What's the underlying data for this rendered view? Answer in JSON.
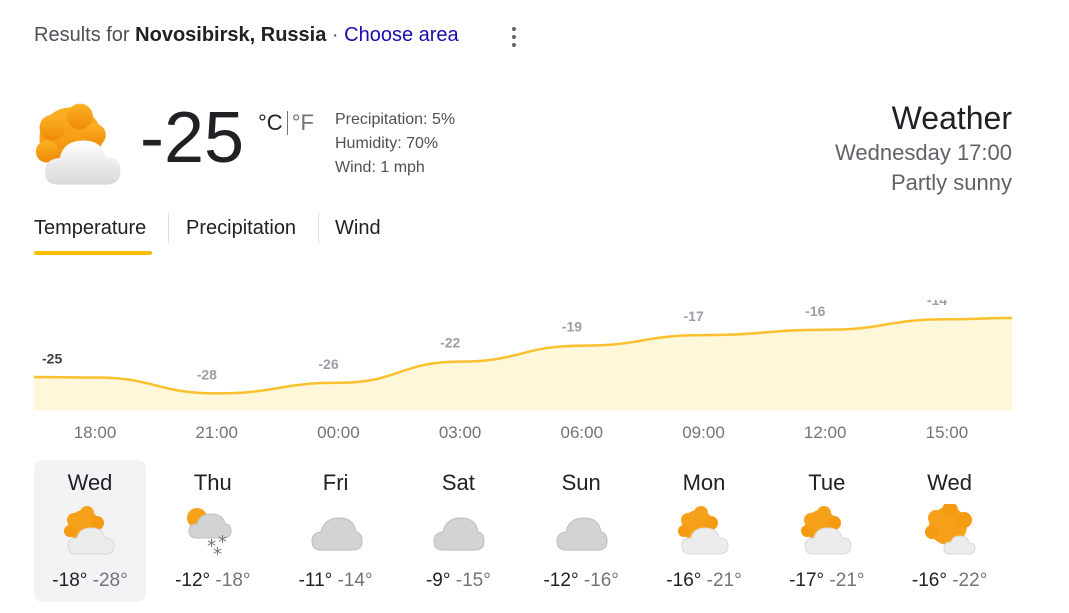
{
  "header": {
    "results_prefix": "Results for",
    "location": "Novosibirsk, Russia",
    "separator": "·",
    "choose_area": "Choose area"
  },
  "current": {
    "icon": "partly-sunny-icon",
    "temperature": "-25",
    "unit_c": "°C",
    "unit_f": "°F",
    "precipitation": "Precipitation: 5%",
    "humidity": "Humidity: 70%",
    "wind": "Wind: 1 mph"
  },
  "summary": {
    "title": "Weather",
    "datetime": "Wednesday 17:00",
    "condition": "Partly sunny"
  },
  "tabs": [
    {
      "label": "Temperature",
      "selected": true
    },
    {
      "label": "Precipitation",
      "selected": false
    },
    {
      "label": "Wind",
      "selected": false
    }
  ],
  "chart_data": {
    "type": "area",
    "values": [
      -25,
      -28,
      -26,
      -22,
      -19,
      -17,
      -16,
      -14
    ],
    "labels": [
      "-25",
      "-28",
      "-26",
      "-22",
      "-19",
      "-17",
      "-16",
      "-14"
    ],
    "times": [
      "18:00",
      "21:00",
      "00:00",
      "03:00",
      "06:00",
      "09:00",
      "12:00",
      "15:00"
    ],
    "line_color": "#fbc02d",
    "fill_color": "#fef7d9",
    "label_color_current": "#3c4043",
    "label_color_other": "#9aa0a6"
  },
  "days": [
    {
      "name": "Wed",
      "icon": "partly-sunny-icon",
      "high": "-18°",
      "low": "-28°",
      "selected": true
    },
    {
      "name": "Thu",
      "icon": "snow-partly-cloudy-icon",
      "high": "-12°",
      "low": "-18°",
      "selected": false
    },
    {
      "name": "Fri",
      "icon": "cloudy-icon",
      "high": "-11°",
      "low": "-14°",
      "selected": false
    },
    {
      "name": "Sat",
      "icon": "cloudy-icon",
      "high": "-9°",
      "low": "-15°",
      "selected": false
    },
    {
      "name": "Sun",
      "icon": "cloudy-icon",
      "high": "-12°",
      "low": "-16°",
      "selected": false
    },
    {
      "name": "Mon",
      "icon": "partly-sunny-icon",
      "high": "-16°",
      "low": "-21°",
      "selected": false
    },
    {
      "name": "Tue",
      "icon": "partly-sunny-icon",
      "high": "-17°",
      "low": "-21°",
      "selected": false
    },
    {
      "name": "Wed",
      "icon": "mostly-sunny-icon",
      "high": "-16°",
      "low": "-22°",
      "selected": false
    }
  ],
  "colors": {
    "accent": "#fbbc04",
    "link": "#1a0dab",
    "sun": "#f59c0b",
    "cloud": "#e8e8e8"
  }
}
